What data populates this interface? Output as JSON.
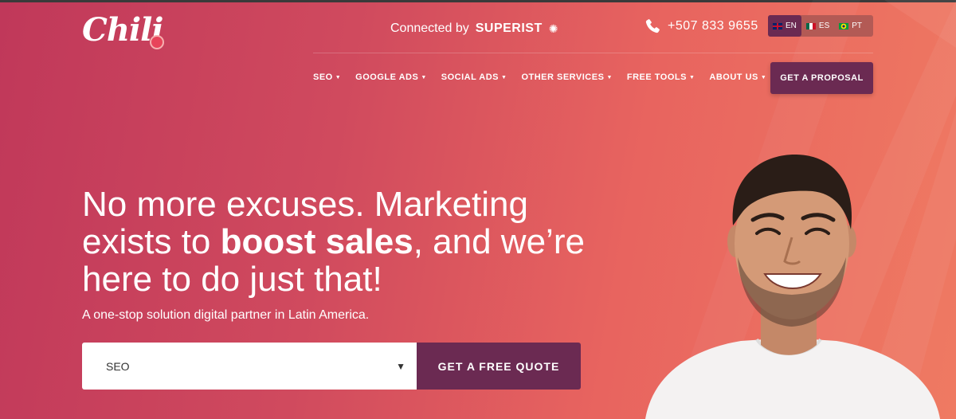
{
  "header": {
    "logo_text": "Chili",
    "connected_label": "Connected by",
    "connected_brand": "SUPERIST",
    "phone": "+507 833 9655",
    "languages": [
      {
        "code": "EN",
        "active": true
      },
      {
        "code": "ES",
        "active": false
      },
      {
        "code": "PT",
        "active": false
      }
    ]
  },
  "nav": {
    "items": [
      {
        "label": "SEO"
      },
      {
        "label": "GOOGLE ADS"
      },
      {
        "label": "SOCIAL ADS"
      },
      {
        "label": "OTHER SERVICES"
      },
      {
        "label": "FREE TOOLS"
      },
      {
        "label": "ABOUT US"
      }
    ],
    "cta_label": "GET A PROPOSAL"
  },
  "hero": {
    "headline_part1": "No more excuses. Marketing exists to",
    "headline_bold": "boost sales",
    "headline_part2": ", and we’re here to do just that!",
    "subtitle": "A one-stop solution digital partner in Latin America.",
    "select_value": "SEO",
    "quote_button": "GET A FREE QUOTE"
  },
  "colors": {
    "accent": "#6b2a52",
    "bg_start": "#c0385a",
    "bg_end": "#ef7a62"
  }
}
